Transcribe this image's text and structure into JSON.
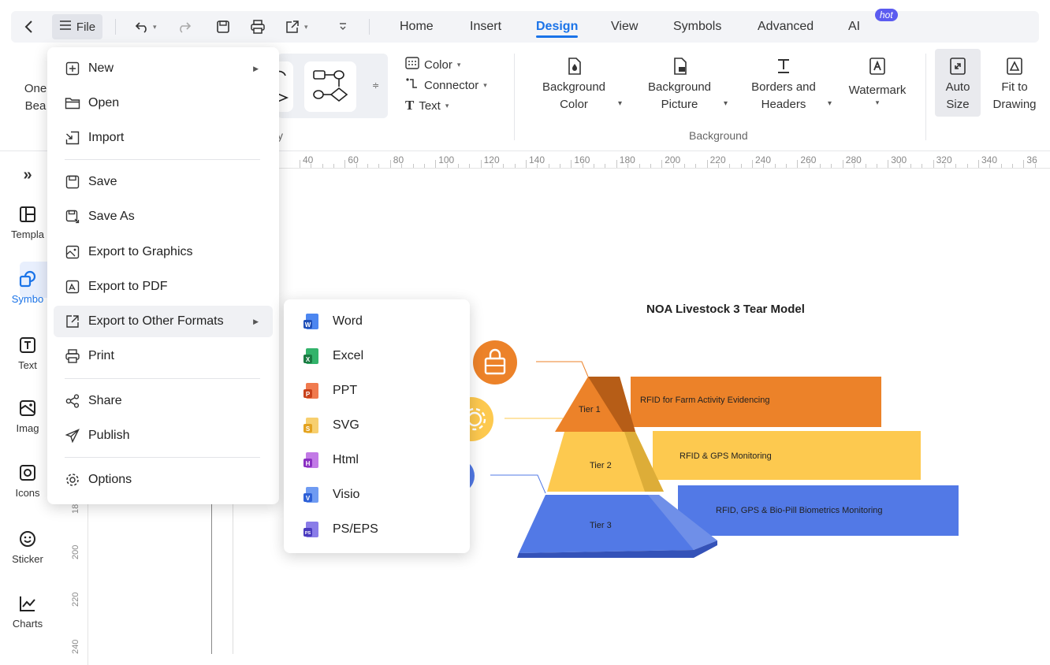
{
  "menubar": {
    "file_label": "File",
    "tabs": [
      "Home",
      "Insert",
      "Design",
      "View",
      "Symbols",
      "Advanced",
      "AI"
    ],
    "active_tab": "Design",
    "hot_badge": "hot"
  },
  "ribbon": {
    "left_partial": [
      "One",
      "Bea"
    ],
    "small_cmds": {
      "color": "Color",
      "connector": "Connector",
      "text": "Text"
    },
    "background_color": [
      "Background",
      "Color"
    ],
    "background_picture": [
      "Background",
      "Picture"
    ],
    "borders_headers": [
      "Borders and",
      "Headers"
    ],
    "watermark": "Watermark",
    "auto_size": [
      "Auto",
      "Size"
    ],
    "fit_drawing": [
      "Fit to",
      "Drawing"
    ],
    "group_background": "Background",
    "group_partial": "y"
  },
  "sidebar": {
    "items": [
      "Templa",
      "Symbo",
      "Text",
      "Imag",
      "Icons",
      "Sticker",
      "Charts"
    ]
  },
  "ruler": {
    "h_labels": [
      "40",
      "60",
      "80",
      "100",
      "120",
      "140",
      "160",
      "180",
      "200",
      "220",
      "240",
      "260",
      "280",
      "300",
      "320",
      "340",
      "36"
    ],
    "v_labels": [
      "18",
      "200",
      "220",
      "240"
    ]
  },
  "file_menu": {
    "items": [
      "New",
      "Open",
      "Import",
      "Save",
      "Save As",
      "Export to Graphics",
      "Export to PDF",
      "Export to Other Formats",
      "Print",
      "Share",
      "Publish",
      "Options"
    ]
  },
  "export_submenu": {
    "items": [
      {
        "label": "Word",
        "color": "#2b5fd9",
        "letter": "W"
      },
      {
        "label": "Excel",
        "color": "#1f8a4c",
        "letter": "X"
      },
      {
        "label": "PPT",
        "color": "#e0532a",
        "letter": "P"
      },
      {
        "label": "SVG",
        "color": "#f2b233",
        "letter": "S"
      },
      {
        "label": "Html",
        "color": "#9a3fd0",
        "letter": "H"
      },
      {
        "label": "Visio",
        "color": "#3a6fe0",
        "letter": "V"
      },
      {
        "label": "PS/EPS",
        "color": "#5546c9",
        "letter": "PS"
      }
    ]
  },
  "diagram": {
    "title": "NOA Livestock 3 Tear Model",
    "tiers": [
      {
        "tier": "Tier 1",
        "label": "RFID for Farm Activity Evidencing",
        "color": "#ec8229"
      },
      {
        "tier": "Tier 2",
        "label": "RFID & GPS Monitoring",
        "color": "#fdc94f"
      },
      {
        "tier": "Tier 3",
        "label": "RFID, GPS & Bio-Pill Biometrics Monitoring",
        "color": "#5279e6"
      }
    ]
  }
}
